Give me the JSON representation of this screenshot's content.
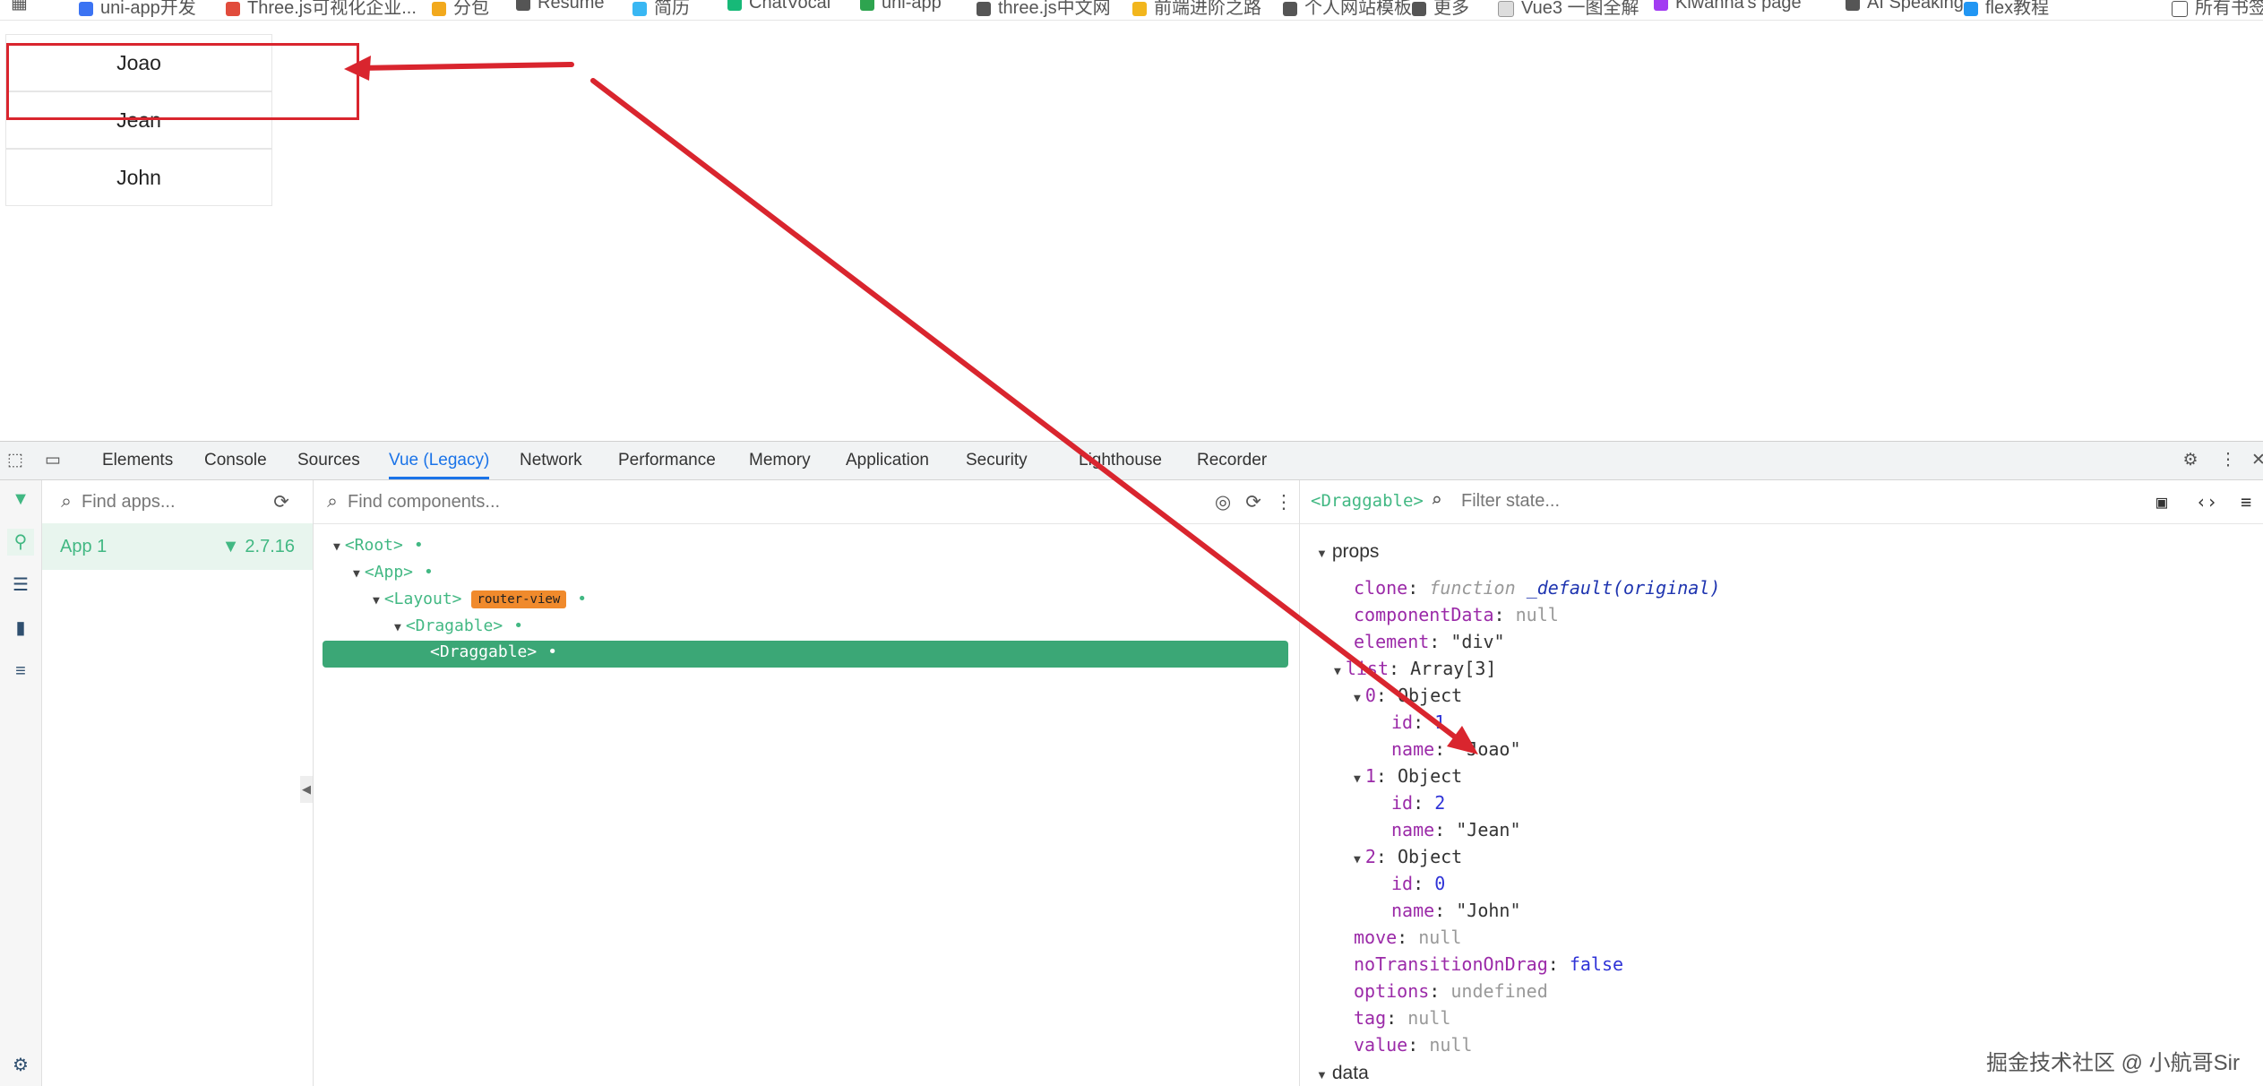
{
  "bookmarks": [
    {
      "label": "uni-app开发",
      "color": "#3b73f3"
    },
    {
      "label": "Three.js可视化企业...",
      "color": "#e14c3c"
    },
    {
      "label": "分包",
      "color": "#f2a91d"
    },
    {
      "label": "Resume",
      "color": "#555555"
    },
    {
      "label": "简历",
      "color": "#39b7f3"
    },
    {
      "label": "ChatVocal",
      "color": "#17b978"
    },
    {
      "label": "uni-app",
      "color": "#2ea44f"
    },
    {
      "label": "three.js中文网",
      "color": "#555555"
    },
    {
      "label": "前端进阶之路",
      "color": "#f2b61d"
    },
    {
      "label": "个人网站模板",
      "color": "#555555"
    },
    {
      "label": "更多",
      "color": "#555555"
    },
    {
      "label": "Vue3 一图全解",
      "color": "#dddddd"
    },
    {
      "label": "Kiwanna's page",
      "color": "#a23cf2"
    },
    {
      "label": "AI Speaking",
      "color": "#555555"
    },
    {
      "label": "flex教程",
      "color": "#2196f3"
    },
    {
      "label": "所有书签",
      "color": "#555555"
    }
  ],
  "page": {
    "items": [
      "Joao",
      "Jean",
      "John"
    ]
  },
  "devtools": {
    "tabs": [
      "Elements",
      "Console",
      "Sources",
      "Vue (Legacy)",
      "Network",
      "Performance",
      "Memory",
      "Application",
      "Security",
      "Lighthouse",
      "Recorder"
    ],
    "active_tab": "Vue (Legacy)",
    "apps_search_placeholder": "Find apps...",
    "app": {
      "name": "App 1",
      "version": "2.7.16"
    },
    "components_search_placeholder": "Find components...",
    "tree": {
      "root": "<Root>",
      "app": "<App>",
      "layout": "<Layout>",
      "layout_badge": "router-view",
      "dragable": "<Dragable>",
      "draggable": "<Draggable>"
    },
    "state": {
      "component": "<Draggable>",
      "filter_placeholder": "Filter state...",
      "section": "props",
      "props": {
        "clone_key": "clone",
        "clone_kw": "function",
        "clone_fn": "_default(original)",
        "componentData_key": "componentData",
        "componentData_val": "null",
        "element_key": "element",
        "element_val": "\"div\"",
        "list_key": "list",
        "list_val": "Array[3]",
        "items": [
          {
            "index": "0",
            "type": "Object",
            "id": "1",
            "name": "\"Joao\""
          },
          {
            "index": "1",
            "type": "Object",
            "id": "2",
            "name": "\"Jean\""
          },
          {
            "index": "2",
            "type": "Object",
            "id": "0",
            "name": "\"John\""
          }
        ],
        "move_key": "move",
        "move_val": "null",
        "noTransition_key": "noTransitionOnDrag",
        "noTransition_val": "false",
        "options_key": "options",
        "options_val": "undefined",
        "tag_key": "tag",
        "tag_val": "null",
        "value_key": "value",
        "value_val": "null"
      },
      "next_section": "data"
    }
  },
  "watermark": "掘金技术社区 @ 小航哥Sir"
}
